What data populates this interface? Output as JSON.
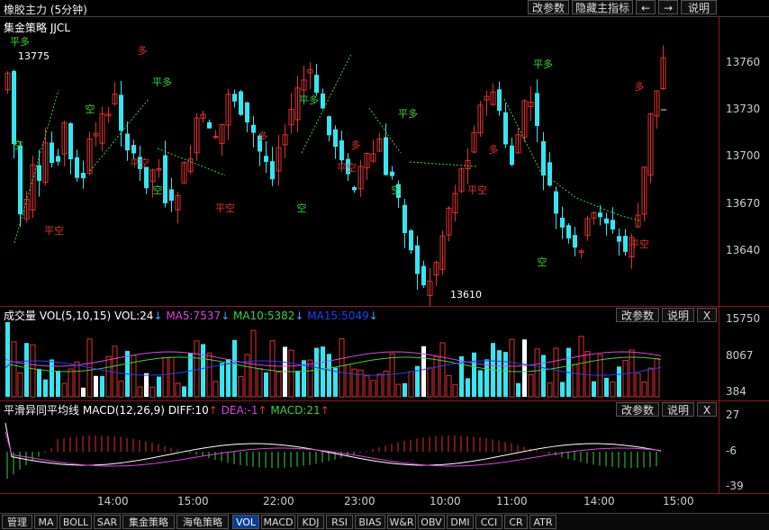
{
  "header": {
    "title": "橡胶主力 (5分钟)",
    "buttons": [
      "改参数",
      "隐藏主指标",
      "←",
      "→",
      "说明"
    ],
    "strategy": "集金策略 JJCL"
  },
  "main": {
    "yticks": [
      "13760",
      "13730",
      "13700",
      "13670",
      "13640"
    ],
    "high_label": "13775",
    "low_label": "13610",
    "signals": [
      {
        "text": "平多",
        "color": "#3cd23c"
      },
      {
        "text": "空",
        "color": "#3cd23c"
      },
      {
        "text": "平空",
        "color": "#e03030"
      },
      {
        "text": "多",
        "color": "#e03030"
      }
    ]
  },
  "vol": {
    "label": "成交量",
    "params": "VOL(5,10,15)",
    "vol": "VOL:24",
    "ma5": "MA5:7537",
    "ma10": "MA10:5382",
    "ma15": "MA15:5049",
    "yticks": [
      "15750",
      "8067",
      "384"
    ],
    "buttons": [
      "改参数",
      "说明",
      "X"
    ]
  },
  "macd": {
    "label": "平滑异同平均线",
    "params": "MACD(12,26,9)",
    "diff": "DIFF:10",
    "dea": "DEA:-1",
    "macd": "MACD:21",
    "yticks": [
      "27",
      "-6",
      "-39"
    ],
    "buttons": [
      "改参数",
      "说明",
      "X"
    ]
  },
  "time_axis": [
    "14:00",
    "15:00",
    "22:00",
    "23:00",
    "10:00",
    "11:00",
    "14:00",
    "15:00"
  ],
  "tabs": [
    "管理",
    "MA",
    "BOLL",
    "SAR",
    "集金策略",
    "海龟策略",
    "VOL",
    "MACD",
    "KDJ",
    "RSI",
    "BIAS",
    "W&R",
    "OBV",
    "DMI",
    "CCI",
    "CR",
    "ATR"
  ],
  "active_tab": "VOL",
  "colors": {
    "up": "#e03030",
    "down": "#35e6f0",
    "ma5": "#e040e0",
    "ma10": "#3cd23c",
    "ma15": "#2040ff",
    "dea": "#e040e0"
  }
}
